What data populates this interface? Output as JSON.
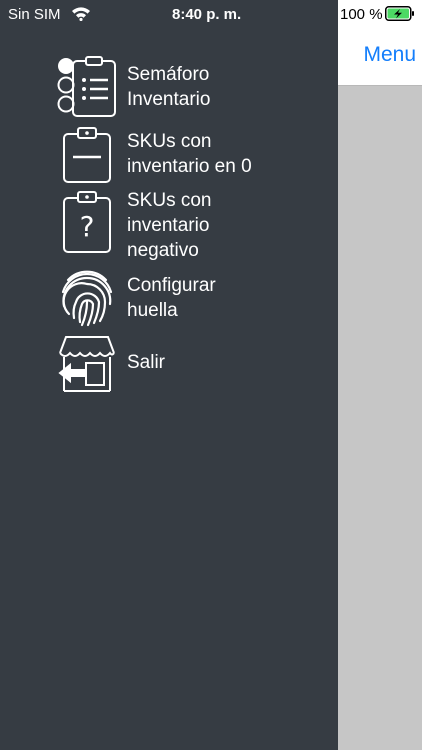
{
  "status_bar": {
    "carrier": "Sin SIM",
    "time": "8:40 p. m.",
    "battery_percent": "100 %",
    "wifi_icon": "wifi-icon",
    "battery_icon": "battery-charging-icon"
  },
  "main": {
    "menu_link": "Menu"
  },
  "drawer": {
    "items": [
      {
        "label": "Semáforo\nInventario",
        "icon": "traffic-light-checklist-icon"
      },
      {
        "label": "SKUs con\ninventario en 0",
        "icon": "clipboard-empty-icon"
      },
      {
        "label": "SKUs con\ninventario\nnegativo",
        "icon": "clipboard-question-icon"
      },
      {
        "label": "Configurar\nhuella",
        "icon": "fingerprint-icon"
      },
      {
        "label": "Salir",
        "icon": "store-exit-icon"
      }
    ]
  },
  "colors": {
    "drawer_background": "#363c43",
    "accent_blue": "#147efb",
    "page_background": "#c6c6c6",
    "battery_green": "#4cd964"
  }
}
